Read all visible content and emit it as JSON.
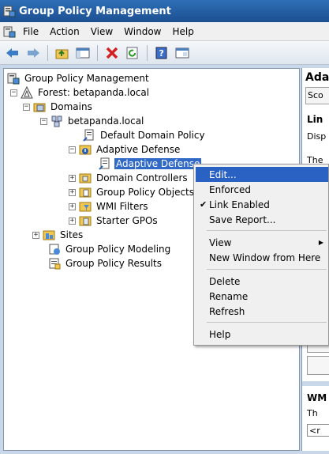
{
  "window": {
    "title": "Group Policy Management"
  },
  "menu": [
    "File",
    "Action",
    "View",
    "Window",
    "Help"
  ],
  "toolbar": [
    "back-icon",
    "forward-icon",
    "up-folder-icon",
    "show-hide-tree-icon",
    "delete-icon",
    "refresh-icon",
    "help-icon",
    "properties-icon"
  ],
  "tree": {
    "root": "Group Policy Management",
    "forest": "Forest: betapanda.local",
    "domains": "Domains",
    "domain": "betapanda.local",
    "default_policy": "Default Domain Policy",
    "ou": "Adaptive Defense",
    "gpo_link": "Adaptive Defense",
    "domain_controllers": "Domain Controllers",
    "gpo_objects": "Group Policy Objects",
    "wmi_filters": "WMI Filters",
    "starter_gpos": "Starter GPOs",
    "sites": "Sites",
    "modeling": "Group Policy Modeling",
    "results": "Group Policy Results"
  },
  "right_pane": {
    "title": "Ada",
    "tab": "Sco",
    "heading": "Lin",
    "text1": "Disp",
    "text2": "The",
    "heading2": "WM",
    "text3": "Th",
    "input": "<r"
  },
  "context_menu": {
    "edit": "Edit...",
    "enforced": "Enforced",
    "link_enabled": "Link Enabled",
    "save_report": "Save Report...",
    "view": "View",
    "new_window": "New Window from Here",
    "delete": "Delete",
    "rename": "Rename",
    "refresh": "Refresh",
    "help": "Help"
  },
  "colors": {
    "title_bar": "#1c4f92",
    "selection": "#3169c6",
    "menu_highlight": "#2a62c4"
  }
}
